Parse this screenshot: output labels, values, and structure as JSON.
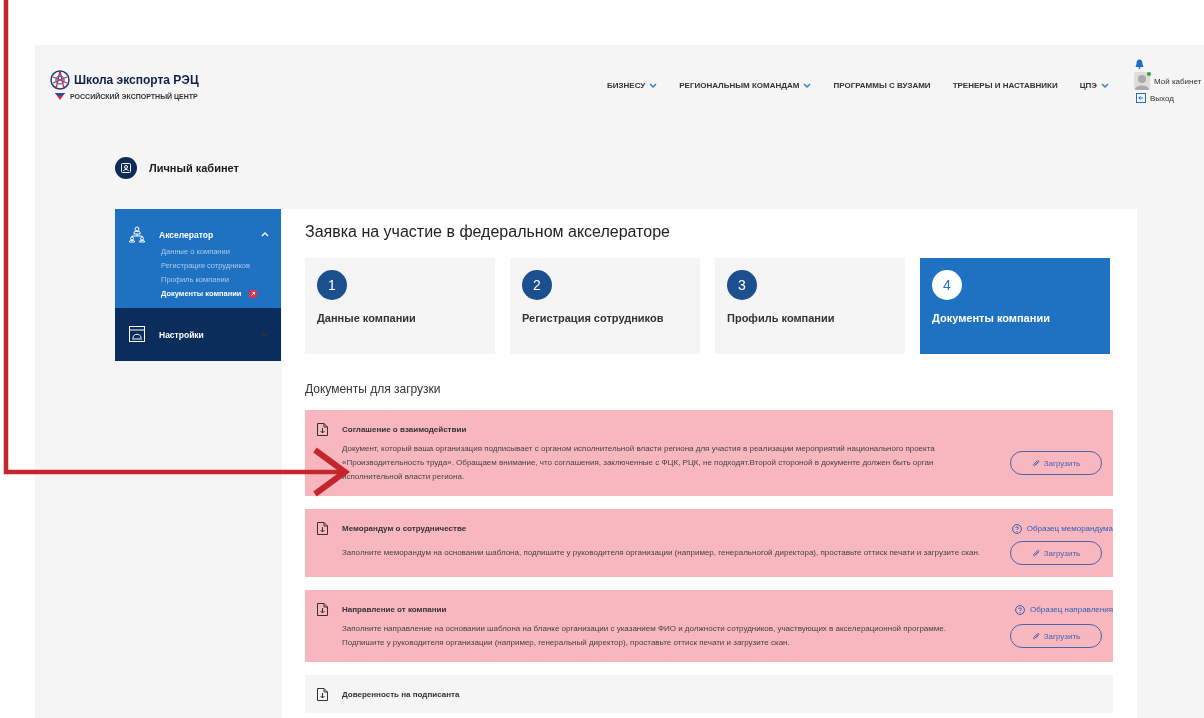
{
  "header": {
    "logo_title": "Школа экспорта РЭЦ",
    "logo_subtitle": "РОССИЙСКИЙ ЭКСПОРТНЫЙ ЦЕНТР",
    "nav": [
      {
        "label": "БИЗНЕСУ",
        "dropdown": true
      },
      {
        "label": "РЕГИОНАЛЬНЫМ КОМАНДАМ",
        "dropdown": true
      },
      {
        "label": "ПРОГРАММЫ С ВУЗАМИ",
        "dropdown": false
      },
      {
        "label": "ТРЕНЕРЫ И НАСТАВНИКИ",
        "dropdown": false
      },
      {
        "label": "ЦПЭ",
        "dropdown": true
      }
    ],
    "user": {
      "cabinet": "Мой кабинет",
      "logout": "Выход",
      "online": true
    }
  },
  "page_title": "Личный кабинет",
  "sidebar": {
    "sections": [
      {
        "label": "Акселератор",
        "expanded": true,
        "children": [
          {
            "label": "Данные о компании",
            "selected": false,
            "badge": false
          },
          {
            "label": "Регистрация сотрудников",
            "selected": false,
            "badge": false
          },
          {
            "label": "Профиль компании",
            "selected": false,
            "badge": false
          },
          {
            "label": "Документы компании",
            "selected": true,
            "badge": true
          }
        ]
      },
      {
        "label": "Настройки",
        "expanded": false
      }
    ]
  },
  "form": {
    "title": "Заявка на участие в федеральном акселераторе",
    "steps": [
      {
        "number": "1",
        "label": "Данные компании",
        "selected": false
      },
      {
        "number": "2",
        "label": "Регистрация сотрудников",
        "selected": false
      },
      {
        "number": "3",
        "label": "Профиль компании",
        "selected": false
      },
      {
        "number": "4",
        "label": "Документы компании",
        "selected": true
      }
    ],
    "documents_title": "Документы для загрузки",
    "documents": [
      {
        "title": "Соглашение о взаимодействии",
        "highlighted": true,
        "lines": [
          "Документ, который ваша организация подписывает с органом исполнительной власти региона для участия в реализации мероприятий национального проекта",
          "«Производительность труда». Обращаем внимание, что соглашения, заключенные с ФЦК, РЦК, не подходят.Второй стороной в документе должен быть орган",
          "исполнительной власти региона."
        ],
        "upload": "Загрузить"
      },
      {
        "title": "Меморандум о сотрудничестве",
        "highlighted": true,
        "sample": "Образец меморандума",
        "lines": [
          "Заполните меморандум на основании шаблона, подпишите у руководителя организации (например, генеральногой директора), проставьте оттиск печати и загрузите скан."
        ],
        "upload": "Загрузить"
      },
      {
        "title": "Направление от компании",
        "highlighted": true,
        "sample": "Образец направления",
        "lines": [
          "Заполните направление на основании шаблона на бланке организации с указанием ФИО и должности сотрудников, участвующих в акселерационной программе.",
          "Подпишите у руководителя организации (например, генеральный директор), проставьте оттиск печати и загрузите скан."
        ],
        "upload": "Загрузить"
      },
      {
        "title": "Доверенность на подписанта",
        "highlighted": false
      }
    ]
  }
}
